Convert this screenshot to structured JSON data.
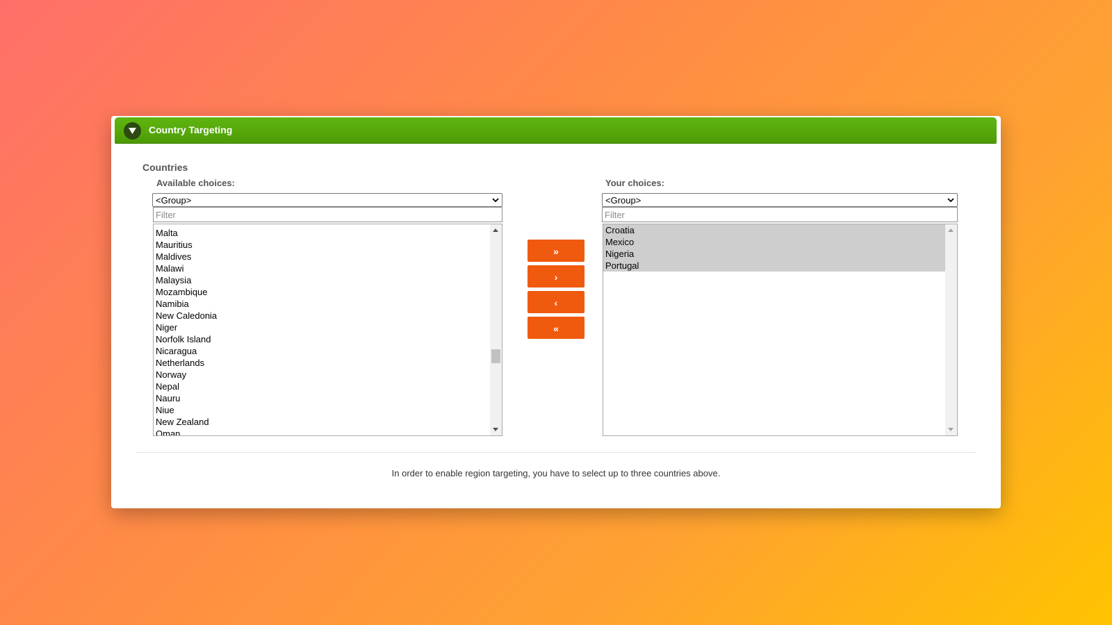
{
  "panel": {
    "title": "Country Targeting",
    "collapse_icon": "triangle-down-icon",
    "section_title": "Countries",
    "help_text": "In order to enable region targeting, you have to select up to three countries above."
  },
  "available": {
    "label": "Available choices:",
    "group_select": "<Group>",
    "filter_placeholder": "Filter",
    "items": [
      "Malta",
      "Mauritius",
      "Maldives",
      "Malawi",
      "Malaysia",
      "Mozambique",
      "Namibia",
      "New Caledonia",
      "Niger",
      "Norfolk Island",
      "Nicaragua",
      "Netherlands",
      "Norway",
      "Nepal",
      "Nauru",
      "Niue",
      "New Zealand",
      "Oman"
    ]
  },
  "chosen": {
    "label": "Your choices:",
    "group_select": "<Group>",
    "filter_placeholder": "Filter",
    "items": [
      "Croatia",
      "Mexico",
      "Nigeria",
      "Portugal"
    ]
  },
  "buttons": {
    "add_all": "»",
    "add_selected": "›",
    "remove_selected": "‹",
    "remove_all": "«"
  },
  "colors": {
    "header_green": "#56a80a",
    "button_orange": "#f05a0e",
    "selected_gray": "#cecece"
  }
}
